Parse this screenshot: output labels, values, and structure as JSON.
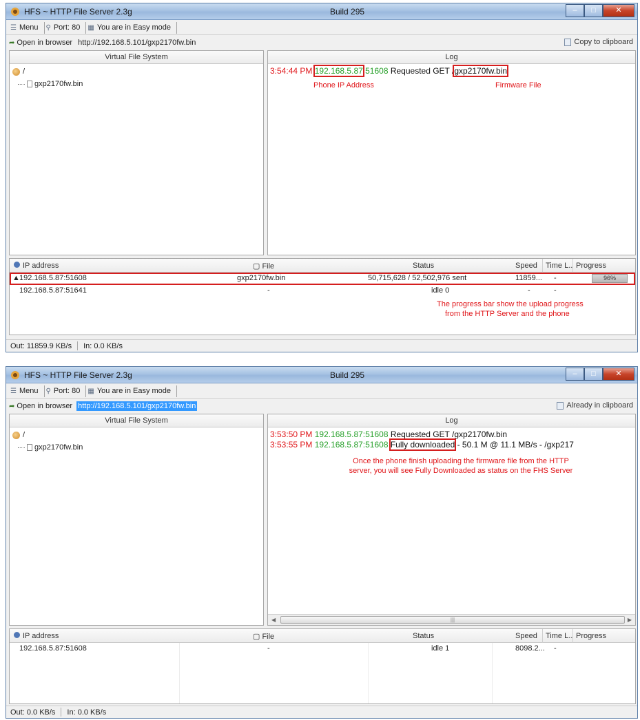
{
  "windows": [
    {
      "title": "HFS ~ HTTP File Server 2.3g",
      "build": "Build 295",
      "toolbar": {
        "menu": "Menu",
        "port": "Port: 80",
        "mode": "You are in Easy mode"
      },
      "urlbar": {
        "label": "Open in browser",
        "url": "http://192.168.5.101/gxp2170fw.bin",
        "clipboard": "Copy to clipboard"
      },
      "vfs": {
        "header": "Virtual File System",
        "root": "/",
        "file": "gxp2170fw.bin"
      },
      "log": {
        "header": "Log",
        "lines": [
          {
            "time": "3:54:44 PM",
            "ip": "192.168.5.87",
            "port": ":51608",
            "action": "Requested GET /",
            "file": "gxp2170fw.bin"
          }
        ]
      },
      "annotations": {
        "phone_ip": "Phone IP Address",
        "firmware_file": "Firmware File",
        "progress_line1": "The progress bar show the upload progress",
        "progress_line2": "from the HTTP Server and the phone"
      },
      "connections": {
        "headers": {
          "ip": "IP address",
          "file": "File",
          "status": "Status",
          "speed": "Speed",
          "time": "Time L..",
          "progress": "Progress"
        },
        "rows": [
          {
            "ip": "192.168.5.87:51608",
            "file": "gxp2170fw.bin",
            "status": "50,715,628 / 52,502,976 sent",
            "speed": "11859...",
            "time": "-",
            "progress": "96%",
            "progress_value": 0.96
          },
          {
            "ip": "192.168.5.87:51641",
            "file": "-",
            "status": "idle 0",
            "speed": "-",
            "time": "-",
            "progress": ""
          }
        ]
      },
      "statusbar": {
        "out": "Out: 11859.9 KB/s",
        "in": "In: 0.0 KB/s"
      }
    },
    {
      "title": "HFS ~ HTTP File Server 2.3g",
      "build": "Build 295",
      "toolbar": {
        "menu": "Menu",
        "port": "Port: 80",
        "mode": "You are in Easy mode"
      },
      "urlbar": {
        "label": "Open in browser",
        "url": "http://192.168.5.101/gxp2170fw.bin",
        "clipboard": "Already in clipboard"
      },
      "vfs": {
        "header": "Virtual File System",
        "root": "/",
        "file": "gxp2170fw.bin"
      },
      "log": {
        "header": "Log",
        "lines": [
          {
            "time": "3:53:50 PM",
            "ip": "192.168.5.87",
            "port": ":51608",
            "action": "Requested GET /gxp2170fw.bin"
          },
          {
            "time": "3:53:55 PM",
            "ip": "192.168.5.87",
            "port": ":51608",
            "status": "Fully downloaded",
            "rest": " - 50.1 M @ 11.1 MB/s - /gxp217"
          }
        ]
      },
      "annotations": {
        "done_line1": "Once the phone finish uploading the firmware file from the HTTP",
        "done_line2": "server, you will see Fully Downloaded as status on the FHS Server"
      },
      "connections": {
        "headers": {
          "ip": "IP address",
          "file": "File",
          "status": "Status",
          "speed": "Speed",
          "time": "Time L..",
          "progress": "Progress"
        },
        "rows": [
          {
            "ip": "192.168.5.87:51608",
            "file": "-",
            "status": "idle 1",
            "speed": "8098.2...",
            "time": "-",
            "progress": ""
          }
        ]
      },
      "statusbar": {
        "out": "Out: 0.0 KB/s",
        "in": "In: 0.0 KB/s"
      }
    }
  ],
  "colors": {
    "annotation_red": "#e0161a",
    "log_green": "#27a02a",
    "titlebar_blue": "#a6c2e3",
    "selection_blue": "#3399ff"
  }
}
